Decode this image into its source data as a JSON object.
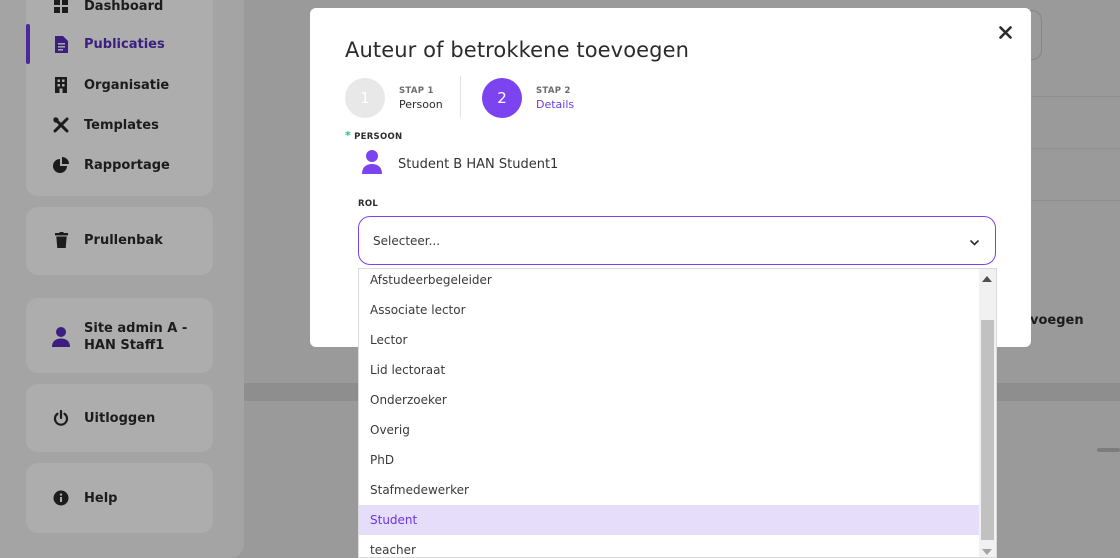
{
  "sidebar": {
    "nav": [
      {
        "label": "Dashboard",
        "icon": "grid-icon"
      },
      {
        "label": "Publicaties",
        "icon": "document-icon",
        "active": true
      },
      {
        "label": "Organisatie",
        "icon": "building-icon"
      },
      {
        "label": "Templates",
        "icon": "tools-icon"
      },
      {
        "label": "Rapportage",
        "icon": "pie-chart-icon"
      }
    ],
    "trash_label": "Prullenbak",
    "user_label_line1": "Site admin A -",
    "user_label_line2": "HAN Staff1",
    "logout_label": "Uitloggen",
    "help_label": "Help"
  },
  "background": {
    "button_fragment": "voegen"
  },
  "modal": {
    "title": "Auteur of betrokkene toevoegen",
    "steps": [
      {
        "number": "1",
        "kicker": "STAP 1",
        "name": "Persoon",
        "state": "done"
      },
      {
        "number": "2",
        "kicker": "STAP 2",
        "name": "Details",
        "state": "active"
      }
    ],
    "person_label": "PERSOON",
    "person_required_mark": "*",
    "person_name": "Student B HAN Student1",
    "role_label": "ROL",
    "role_select_value": "Selecteer..."
  },
  "dropdown": {
    "options": [
      "Afstudeerbegeleider",
      "Associate lector",
      "Lector",
      "Lid lectoraat",
      "Onderzoeker",
      "Overig",
      "PhD",
      "Stafmedewerker",
      "Student",
      "teacher"
    ],
    "highlighted": "Student"
  },
  "colors": {
    "accent": "#7b44f0",
    "accent_text": "#6c3be0",
    "required": "#28c08a",
    "highlight_bg": "#e6ddfb",
    "step_done": "#e8e8e8"
  }
}
